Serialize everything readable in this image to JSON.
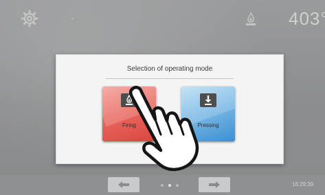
{
  "top_bar": {
    "status_dash": "-",
    "temperature": "403°"
  },
  "dialog": {
    "title": "Selection of operating mode",
    "modes": [
      {
        "label": "Firing",
        "icon": "firing-mode-icon",
        "color": "#e9675f"
      },
      {
        "label": "Pressing",
        "icon": "pressing-mode-icon",
        "color": "#79b8e6"
      }
    ]
  },
  "bottom_bar": {
    "prev_icon": "arrow-left-icon",
    "next_icon": "arrow-right-icon",
    "pages": 3,
    "active_page": 1,
    "clock": "16:29:39"
  }
}
